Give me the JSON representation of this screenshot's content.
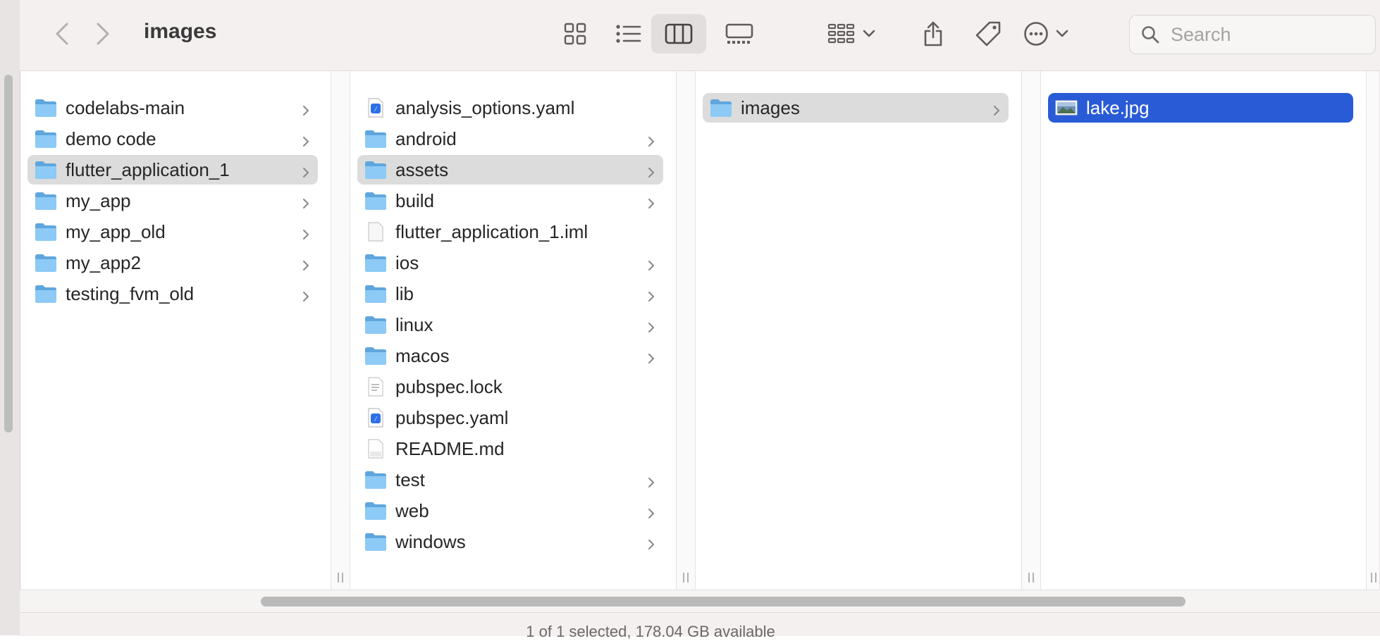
{
  "window": {
    "title": "images"
  },
  "toolbar": {
    "back_icon": "chevron-left-icon",
    "forward_icon": "chevron-right-icon",
    "search": {
      "placeholder": "Search",
      "value": ""
    }
  },
  "columns": [
    {
      "items": [
        {
          "name": "codelabs-main",
          "kind": "folder",
          "has_children": true
        },
        {
          "name": "demo code",
          "kind": "folder",
          "has_children": true
        },
        {
          "name": "flutter_application_1",
          "kind": "folder",
          "has_children": true,
          "selected": "grey"
        },
        {
          "name": "my_app",
          "kind": "folder",
          "has_children": true
        },
        {
          "name": "my_app_old",
          "kind": "folder",
          "has_children": true
        },
        {
          "name": "my_app2",
          "kind": "folder",
          "has_children": true
        },
        {
          "name": "testing_fvm_old",
          "kind": "folder",
          "has_children": true
        }
      ]
    },
    {
      "items": [
        {
          "name": "analysis_options.yaml",
          "kind": "yaml",
          "has_children": false
        },
        {
          "name": "android",
          "kind": "folder",
          "has_children": true
        },
        {
          "name": "assets",
          "kind": "folder",
          "has_children": true,
          "selected": "grey"
        },
        {
          "name": "build",
          "kind": "folder",
          "has_children": true
        },
        {
          "name": "flutter_application_1.iml",
          "kind": "file",
          "has_children": false
        },
        {
          "name": "ios",
          "kind": "folder",
          "has_children": true
        },
        {
          "name": "lib",
          "kind": "folder",
          "has_children": true
        },
        {
          "name": "linux",
          "kind": "folder",
          "has_children": true
        },
        {
          "name": "macos",
          "kind": "folder",
          "has_children": true
        },
        {
          "name": "pubspec.lock",
          "kind": "text",
          "has_children": false
        },
        {
          "name": "pubspec.yaml",
          "kind": "yaml",
          "has_children": false
        },
        {
          "name": "README.md",
          "kind": "md",
          "has_children": false
        },
        {
          "name": "test",
          "kind": "folder",
          "has_children": true
        },
        {
          "name": "web",
          "kind": "folder",
          "has_children": true
        },
        {
          "name": "windows",
          "kind": "folder",
          "has_children": true
        }
      ]
    },
    {
      "items": [
        {
          "name": "images",
          "kind": "folder",
          "has_children": true,
          "selected": "grey"
        }
      ]
    },
    {
      "items": [
        {
          "name": "lake.jpg",
          "kind": "image",
          "has_children": false,
          "selected": "blue"
        }
      ]
    }
  ],
  "status_bar": {
    "text": "1 of 1 selected, 178.04 GB available"
  },
  "colors": {
    "selection_blue": "#2a5bd7",
    "selection_grey": "#dcdcdc",
    "folder_blue": "#63b3ee"
  }
}
